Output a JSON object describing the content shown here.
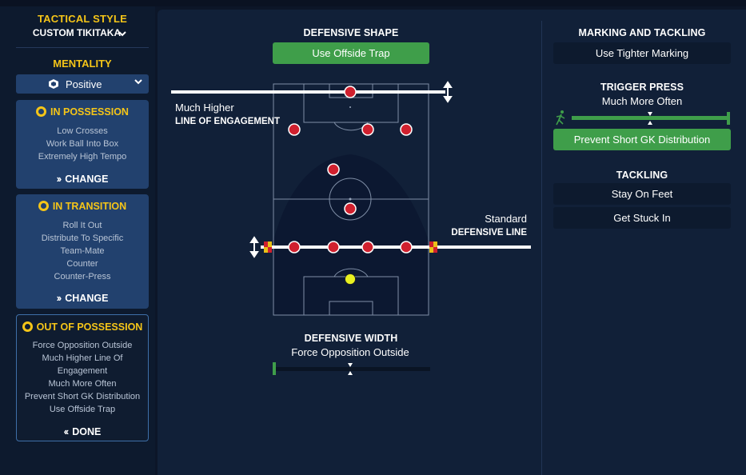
{
  "sidebar": {
    "tactical_style_label": "TACTICAL STYLE",
    "tactical_style_value": "CUSTOM TIKITAKA",
    "mentality_label": "MENTALITY",
    "mentality_value": "Positive",
    "in_possession": {
      "title": "IN POSSESSION",
      "items": [
        "Low Crosses",
        "Work Ball Into Box",
        "Extremely High Tempo"
      ],
      "button": "CHANGE"
    },
    "in_transition": {
      "title": "IN TRANSITION",
      "items": [
        "Roll It Out",
        "Distribute To Specific",
        "Team-Mate",
        "Counter",
        "Counter-Press"
      ],
      "button": "CHANGE"
    },
    "out_of_possession": {
      "title": "OUT OF POSSESSION",
      "items": [
        "Force Opposition Outside",
        "Much Higher Line Of",
        "Engagement",
        "Much More Often",
        "Prevent Short GK Distribution",
        "Use Offside Trap"
      ],
      "button": "DONE"
    }
  },
  "defensive_shape": {
    "title": "DEFENSIVE SHAPE",
    "offside_button": "Use Offside Trap",
    "line_of_engagement_value": "Much Higher",
    "line_of_engagement_label": "LINE OF ENGAGEMENT",
    "defensive_line_value": "Standard",
    "defensive_line_label": "DEFENSIVE LINE",
    "width_title": "DEFENSIVE WIDTH",
    "width_value": "Force Opposition Outside",
    "width_level": 0.0
  },
  "marking": {
    "title": "MARKING AND TACKLING",
    "marking_button": "Use Tighter Marking",
    "trigger_press_title": "TRIGGER PRESS",
    "trigger_press_value": "Much More Often",
    "trigger_press_level": 1.0,
    "gk_button": "Prevent Short GK Distribution",
    "tackling_title": "TACKLING",
    "stay_on_feet": "Stay On Feet",
    "get_stuck_in": "Get Stuck In"
  },
  "colors": {
    "accent_yellow": "#f5c518",
    "green": "#3f9e4a",
    "player_red": "#d0202e",
    "goalkeeper_yellow": "#e8f020"
  }
}
